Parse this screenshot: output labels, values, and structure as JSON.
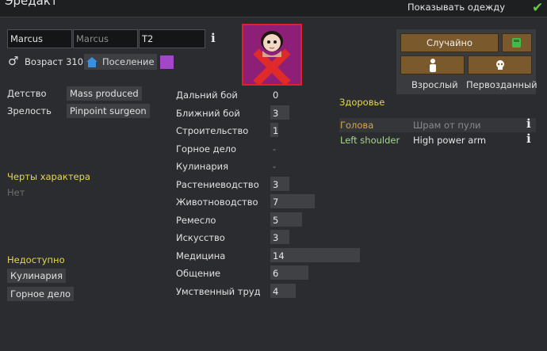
{
  "header": {
    "title_cut": "Эредакт",
    "show_clothes_label": "Показывать одежду",
    "show_clothes_checked": true
  },
  "names": {
    "first": "Marcus",
    "nick_placeholder": "Marcus",
    "last": "T2"
  },
  "identity": {
    "gender_icon": "male-symbol",
    "age_label": "Возраст 310",
    "faction_label": "Поселение",
    "favorite_color": "#a347c7"
  },
  "backstory": {
    "childhood_label": "Детство",
    "childhood_value": "Mass produced",
    "adulthood_label": "Зрелость",
    "adulthood_value": "Pinpoint surgeon"
  },
  "traits": {
    "title": "Черты характера",
    "empty_text": "Нет"
  },
  "incapable": {
    "title": "Недоступно",
    "items": [
      "Кулинария",
      "Горное дело"
    ]
  },
  "skills": [
    {
      "name": "Дальний бой",
      "value": "0",
      "level": 0
    },
    {
      "name": "Ближний бой",
      "value": "3",
      "level": 3
    },
    {
      "name": "Строительство",
      "value": "1",
      "level": 1
    },
    {
      "name": "Горное дело",
      "value": "-",
      "level": null
    },
    {
      "name": "Кулинария",
      "value": "-",
      "level": null
    },
    {
      "name": "Растениеводство",
      "value": "3",
      "level": 3
    },
    {
      "name": "Животноводство",
      "value": "7",
      "level": 7
    },
    {
      "name": "Ремесло",
      "value": "5",
      "level": 5
    },
    {
      "name": "Искусство",
      "value": "3",
      "level": 3
    },
    {
      "name": "Медицина",
      "value": "14",
      "level": 14
    },
    {
      "name": "Общение",
      "value": "6",
      "level": 6
    },
    {
      "name": "Умственный труд",
      "value": "4",
      "level": 4
    }
  ],
  "controls": {
    "randomize_label": "Случайно",
    "adult_label": "Взрослый",
    "newborn_label": "Первозданный",
    "button_color": "#7a5a2d",
    "dice_color": "#48b848"
  },
  "health": {
    "title": "Здоровье",
    "rows": [
      {
        "part": "Голова",
        "condition": "Шрам от пули",
        "part_color": "#d9a640"
      },
      {
        "part": "Left shoulder",
        "condition": "High power arm",
        "part_color": "#a8d78a"
      }
    ]
  }
}
